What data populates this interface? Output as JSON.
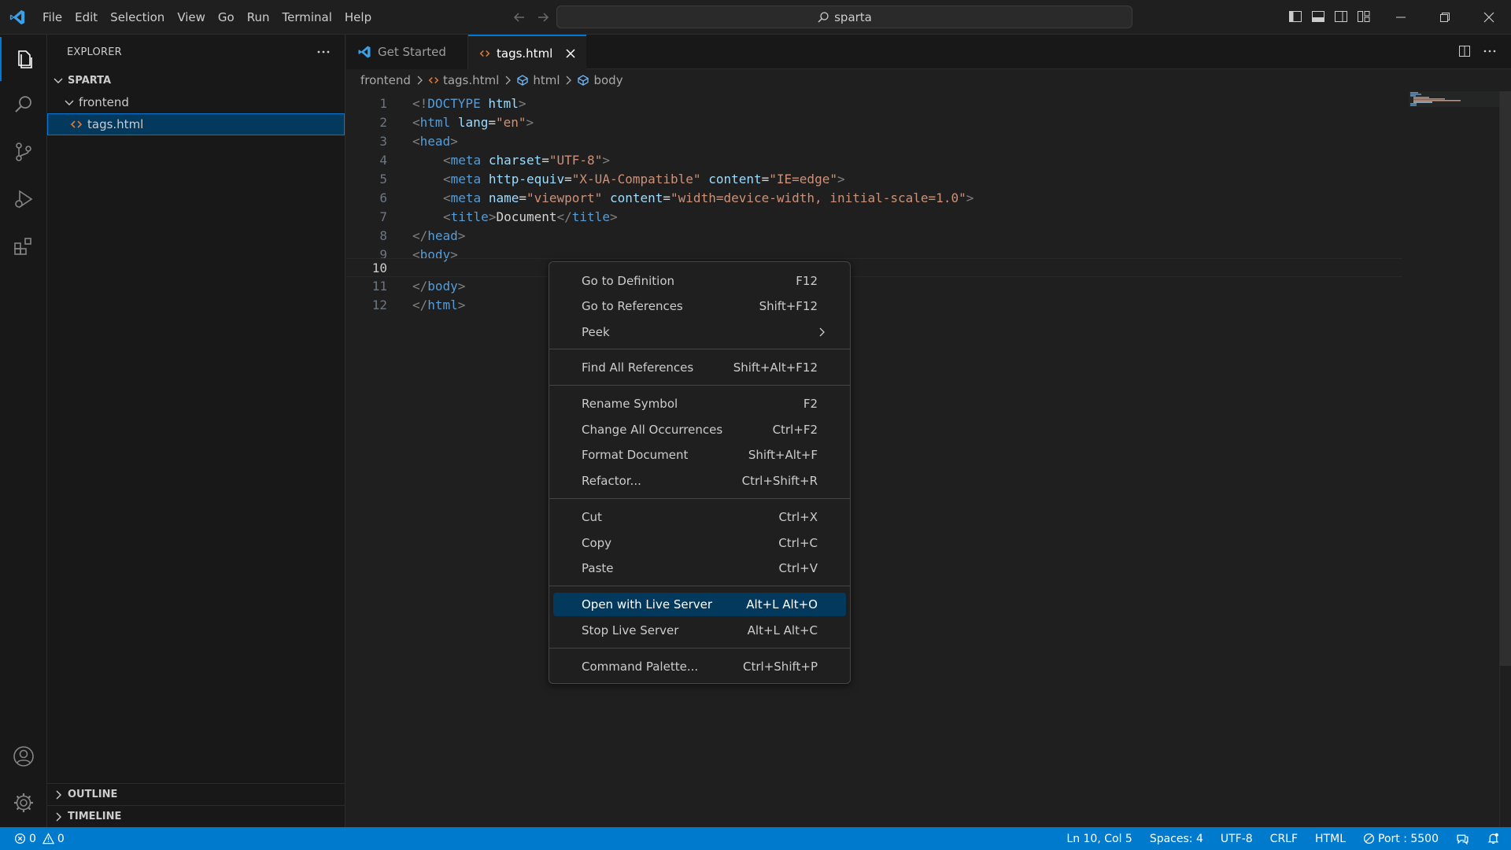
{
  "titlebar": {
    "menus": [
      "File",
      "Edit",
      "Selection",
      "View",
      "Go",
      "Run",
      "Terminal",
      "Help"
    ],
    "search_text": "sparta"
  },
  "sidebar": {
    "title": "EXPLORER",
    "root_folder": "SPARTA",
    "folder": "frontend",
    "file": "tags.html",
    "outline": "OUTLINE",
    "timeline": "TIMELINE"
  },
  "tabs": [
    {
      "label": "Get Started"
    },
    {
      "label": "tags.html"
    }
  ],
  "breadcrumb": [
    "frontend",
    "tags.html",
    "html",
    "body"
  ],
  "editor": {
    "line_numbers": [
      "1",
      "2",
      "3",
      "4",
      "5",
      "6",
      "7",
      "8",
      "9",
      "10",
      "11",
      "12"
    ],
    "lines": {
      "l1": [
        "<!",
        "DOCTYPE",
        " ",
        "html",
        ">"
      ],
      "l2": [
        "<",
        "html",
        " ",
        "lang",
        "=",
        "\"en\"",
        ">"
      ],
      "l3": [
        "<",
        "head",
        ">"
      ],
      "l4": [
        "<",
        "meta",
        " ",
        "charset",
        "=",
        "\"UTF-8\"",
        ">"
      ],
      "l5": [
        "<",
        "meta",
        " ",
        "http-equiv",
        "=",
        "\"X-UA-Compatible\"",
        " ",
        "content",
        "=",
        "\"IE=edge\"",
        ">"
      ],
      "l6": [
        "<",
        "meta",
        " ",
        "name",
        "=",
        "\"viewport\"",
        " ",
        "content",
        "=",
        "\"width=device-width, initial-scale=1.0\"",
        ">"
      ],
      "l7": [
        "<",
        "title",
        ">",
        "Document",
        "</",
        "title",
        ">"
      ],
      "l8": [
        "</",
        "head",
        ">"
      ],
      "l9": [
        "<",
        "body",
        ">"
      ],
      "l11": [
        "</",
        "body",
        ">"
      ],
      "l12": [
        "</",
        "html",
        ">"
      ]
    },
    "current_line": "10"
  },
  "context_menu": {
    "items": [
      {
        "label": "Go to Definition",
        "shortcut": "F12"
      },
      {
        "label": "Go to References",
        "shortcut": "Shift+F12"
      },
      {
        "label": "Peek",
        "shortcut": ""
      },
      {
        "label": "Find All References",
        "shortcut": "Shift+Alt+F12"
      },
      {
        "label": "Rename Symbol",
        "shortcut": "F2"
      },
      {
        "label": "Change All Occurrences",
        "shortcut": "Ctrl+F2"
      },
      {
        "label": "Format Document",
        "shortcut": "Shift+Alt+F"
      },
      {
        "label": "Refactor...",
        "shortcut": "Ctrl+Shift+R"
      },
      {
        "label": "Cut",
        "shortcut": "Ctrl+X"
      },
      {
        "label": "Copy",
        "shortcut": "Ctrl+C"
      },
      {
        "label": "Paste",
        "shortcut": "Ctrl+V"
      },
      {
        "label": "Open with Live Server",
        "shortcut": "Alt+L Alt+O"
      },
      {
        "label": "Stop Live Server",
        "shortcut": "Alt+L Alt+C"
      },
      {
        "label": "Command Palette...",
        "shortcut": "Ctrl+Shift+P"
      }
    ]
  },
  "statusbar": {
    "errors": "0",
    "warnings": "0",
    "position": "Ln 10, Col 5",
    "spaces": "Spaces: 4",
    "encoding": "UTF-8",
    "eol": "CRLF",
    "language": "HTML",
    "port": "Port : 5500"
  },
  "colors": {
    "accent": "#0078d4",
    "statusbar": "#007acc",
    "html_icon": "#e37933",
    "tag": "#569cd6",
    "attribute": "#9cdcfe",
    "string": "#ce9178"
  }
}
